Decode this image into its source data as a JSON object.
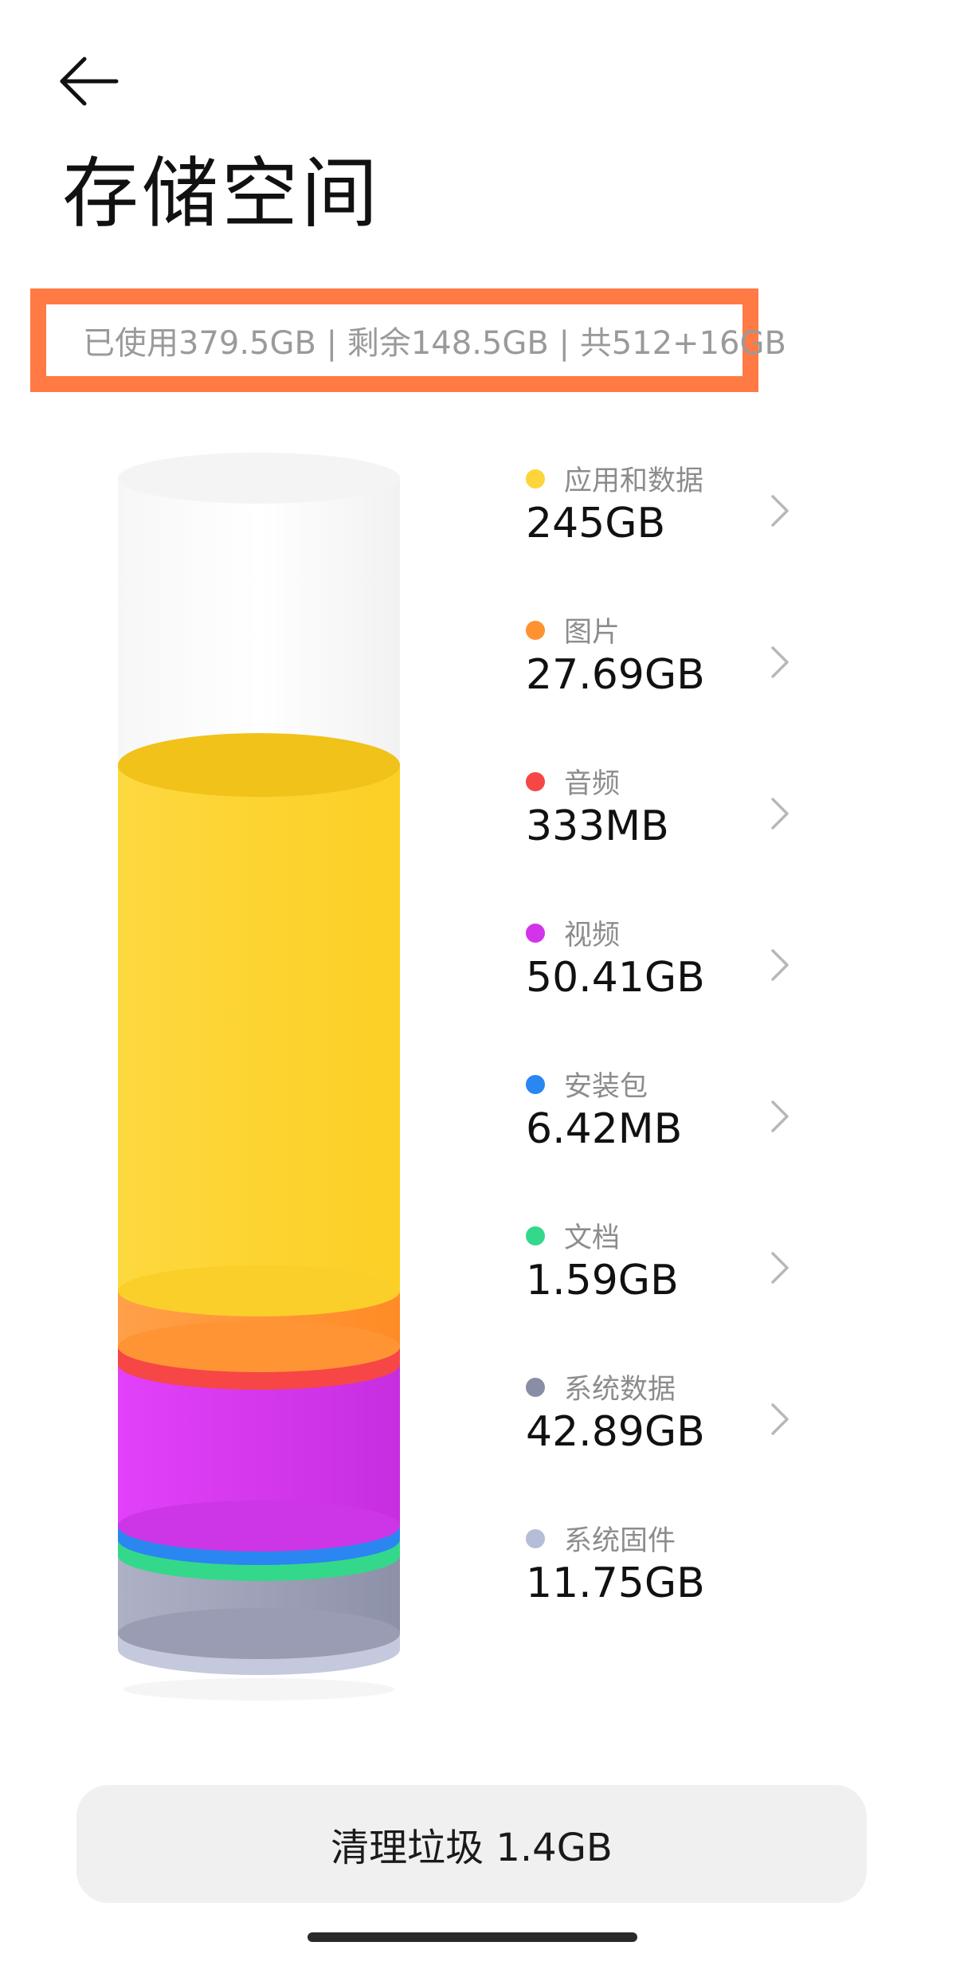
{
  "header": {
    "title": "存储空间"
  },
  "summary": {
    "text": "已使用379.5GB | 剩余148.5GB | 共512+16GB"
  },
  "categories": [
    {
      "label": "应用和数据",
      "value": "245GB",
      "color": "#fcd53a",
      "has_chevron": true
    },
    {
      "label": "图片",
      "value": "27.69GB",
      "color": "#ff9230",
      "has_chevron": true
    },
    {
      "label": "音频",
      "value": "333MB",
      "color": "#f64646",
      "has_chevron": true
    },
    {
      "label": "视频",
      "value": "50.41GB",
      "color": "#d234ea",
      "has_chevron": true
    },
    {
      "label": "安装包",
      "value": "6.42MB",
      "color": "#2a86f1",
      "has_chevron": true
    },
    {
      "label": "文档",
      "value": "1.59GB",
      "color": "#34d88a",
      "has_chevron": true
    },
    {
      "label": "系统数据",
      "value": "42.89GB",
      "color": "#8a8ea4",
      "has_chevron": true
    },
    {
      "label": "系统固件",
      "value": "11.75GB",
      "color": "#b6bdd6",
      "has_chevron": false
    }
  ],
  "clean_button": {
    "label": "清理垃圾 1.4GB"
  },
  "icons": {
    "back": "arrow-left-icon",
    "chevron": "chevron-right-icon"
  }
}
